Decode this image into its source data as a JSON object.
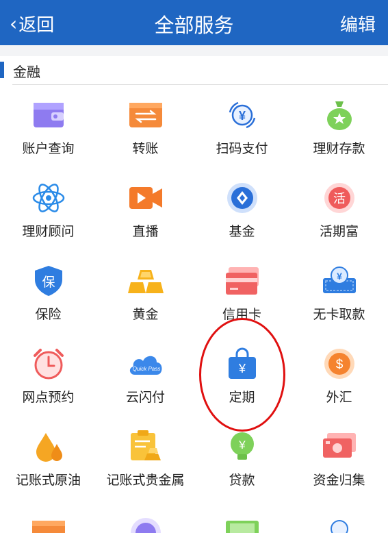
{
  "header": {
    "back_label": "返回",
    "title": "全部服务",
    "edit_label": "编辑"
  },
  "section": {
    "label": "金融"
  },
  "services": [
    {
      "label": "账户查询",
      "icon": "wallet-icon"
    },
    {
      "label": "转账",
      "icon": "transfer-icon"
    },
    {
      "label": "扫码支付",
      "icon": "scan-pay-icon"
    },
    {
      "label": "理财存款",
      "icon": "money-bag-icon"
    },
    {
      "label": "理财顾问",
      "icon": "atom-icon"
    },
    {
      "label": "直播",
      "icon": "video-camera-icon"
    },
    {
      "label": "基金",
      "icon": "fund-coin-icon"
    },
    {
      "label": "活期富",
      "icon": "huo-coin-icon"
    },
    {
      "label": "保险",
      "icon": "shield-icon"
    },
    {
      "label": "黄金",
      "icon": "gold-bars-icon"
    },
    {
      "label": "信用卡",
      "icon": "credit-card-icon"
    },
    {
      "label": "无卡取款",
      "icon": "cardless-withdraw-icon"
    },
    {
      "label": "网点预约",
      "icon": "alarm-clock-icon"
    },
    {
      "label": "云闪付",
      "icon": "quickpass-cloud-icon"
    },
    {
      "label": "定期",
      "icon": "yuan-bag-icon"
    },
    {
      "label": "外汇",
      "icon": "dollar-coin-icon"
    },
    {
      "label": "记账式原油",
      "icon": "oil-drop-icon"
    },
    {
      "label": "记账式贵金属",
      "icon": "precious-metal-icon"
    },
    {
      "label": "贷款",
      "icon": "loan-bulb-icon"
    },
    {
      "label": "资金归集",
      "icon": "cash-collect-icon"
    }
  ],
  "quickpass_text": "Quick Pass",
  "colors": {
    "header": "#1f66c2",
    "highlight": "#e01010"
  }
}
